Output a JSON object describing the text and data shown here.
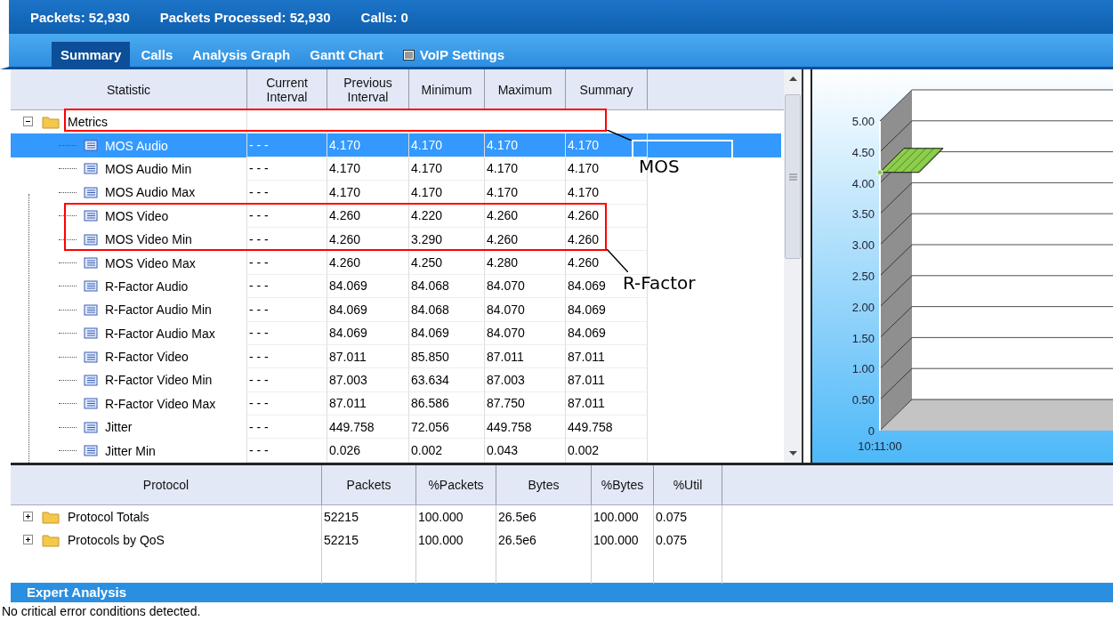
{
  "status_bar": [
    {
      "label": "Packets:",
      "value": "52,930"
    },
    {
      "label": "Packets Processed:",
      "value": "52,930"
    },
    {
      "label": "Calls:",
      "value": "0"
    }
  ],
  "tabs": [
    {
      "label": "Summary",
      "selected": true,
      "kind": "plain"
    },
    {
      "label": "Calls",
      "selected": false,
      "kind": "plain"
    },
    {
      "label": "Analysis Graph",
      "selected": false,
      "kind": "plain"
    },
    {
      "label": "Gantt Chart",
      "selected": false,
      "kind": "plain"
    },
    {
      "label": "VoIP Settings",
      "selected": false,
      "kind": "icon"
    }
  ],
  "stats_table": {
    "columns": [
      "Statistic",
      "Current\nInterval",
      "Previous\nInterval",
      "Minimum",
      "Maximum",
      "Summary"
    ],
    "folder": {
      "label": "Metrics",
      "expanded": true
    },
    "rows": [
      {
        "name": "MOS Audio",
        "selected": true,
        "values": [
          "- - -",
          "4.170",
          "4.170",
          "4.170",
          "4.170"
        ]
      },
      {
        "name": "MOS Audio Min",
        "selected": false,
        "values": [
          "- - -",
          "4.170",
          "4.170",
          "4.170",
          "4.170"
        ]
      },
      {
        "name": "MOS Audio Max",
        "selected": false,
        "values": [
          "- - -",
          "4.170",
          "4.170",
          "4.170",
          "4.170"
        ]
      },
      {
        "name": "MOS Video",
        "selected": false,
        "values": [
          "- - -",
          "4.260",
          "4.220",
          "4.260",
          "4.260"
        ]
      },
      {
        "name": "MOS Video Min",
        "selected": false,
        "values": [
          "- - -",
          "4.260",
          "3.290",
          "4.260",
          "4.260"
        ]
      },
      {
        "name": "MOS Video Max",
        "selected": false,
        "values": [
          "- - -",
          "4.260",
          "4.250",
          "4.280",
          "4.260"
        ]
      },
      {
        "name": "R-Factor Audio",
        "selected": false,
        "values": [
          "- - -",
          "84.069",
          "84.068",
          "84.070",
          "84.069"
        ]
      },
      {
        "name": "R-Factor Audio Min",
        "selected": false,
        "values": [
          "- - -",
          "84.069",
          "84.068",
          "84.070",
          "84.069"
        ]
      },
      {
        "name": "R-Factor Audio Max",
        "selected": false,
        "values": [
          "- - -",
          "84.069",
          "84.069",
          "84.070",
          "84.069"
        ]
      },
      {
        "name": "R-Factor Video",
        "selected": false,
        "values": [
          "- - -",
          "87.011",
          "85.850",
          "87.011",
          "87.011"
        ]
      },
      {
        "name": "R-Factor Video Min",
        "selected": false,
        "values": [
          "- - -",
          "87.003",
          "63.634",
          "87.003",
          "87.011"
        ]
      },
      {
        "name": "R-Factor Video Max",
        "selected": false,
        "values": [
          "- - -",
          "87.011",
          "86.586",
          "87.750",
          "87.011"
        ]
      },
      {
        "name": "Jitter",
        "selected": false,
        "values": [
          "- - -",
          "449.758",
          "72.056",
          "449.758",
          "449.758"
        ]
      },
      {
        "name": "Jitter Min",
        "selected": false,
        "values": [
          "- - -",
          "0.026",
          "0.002",
          "0.043",
          "0.002"
        ]
      }
    ]
  },
  "annotations": [
    {
      "label": "MOS"
    },
    {
      "label": "R-Factor"
    }
  ],
  "chart": {
    "chart_data": {
      "type": "line",
      "x": [
        "10:11:00"
      ],
      "series": [
        {
          "color": "#8ccf4a",
          "marker": "circle",
          "values": [
            4.17
          ]
        }
      ],
      "ylim": [
        0,
        5
      ],
      "yticks": [
        {
          "value": 0,
          "label": "0"
        },
        {
          "value": 0.5,
          "label": "0.50"
        },
        {
          "value": 1,
          "label": "1.00"
        },
        {
          "value": 1.5,
          "label": "1.50"
        },
        {
          "value": 2,
          "label": "2.00"
        },
        {
          "value": 2.5,
          "label": "2.50"
        },
        {
          "value": 3,
          "label": "3.00"
        },
        {
          "value": 3.5,
          "label": "3.50"
        },
        {
          "value": 4,
          "label": "4.00"
        },
        {
          "value": 4.5,
          "label": "4.50"
        },
        {
          "value": 5,
          "label": "5.00"
        }
      ]
    }
  },
  "protocol_table": {
    "columns": [
      "Protocol",
      "Packets",
      "%Packets",
      "Bytes",
      "%Bytes",
      "%Util"
    ],
    "rows": [
      {
        "name": "Protocol Totals",
        "expanded": false,
        "values": [
          "52215",
          "100.000",
          "26.5e6",
          "100.000",
          "0.075"
        ]
      },
      {
        "name": "Protocols by QoS",
        "expanded": false,
        "values": [
          "52215",
          "100.000",
          "26.5e6",
          "100.000",
          "0.075"
        ]
      }
    ]
  },
  "expert_analysis": {
    "title": "Expert Analysis",
    "message": "No critical error conditions detected."
  }
}
